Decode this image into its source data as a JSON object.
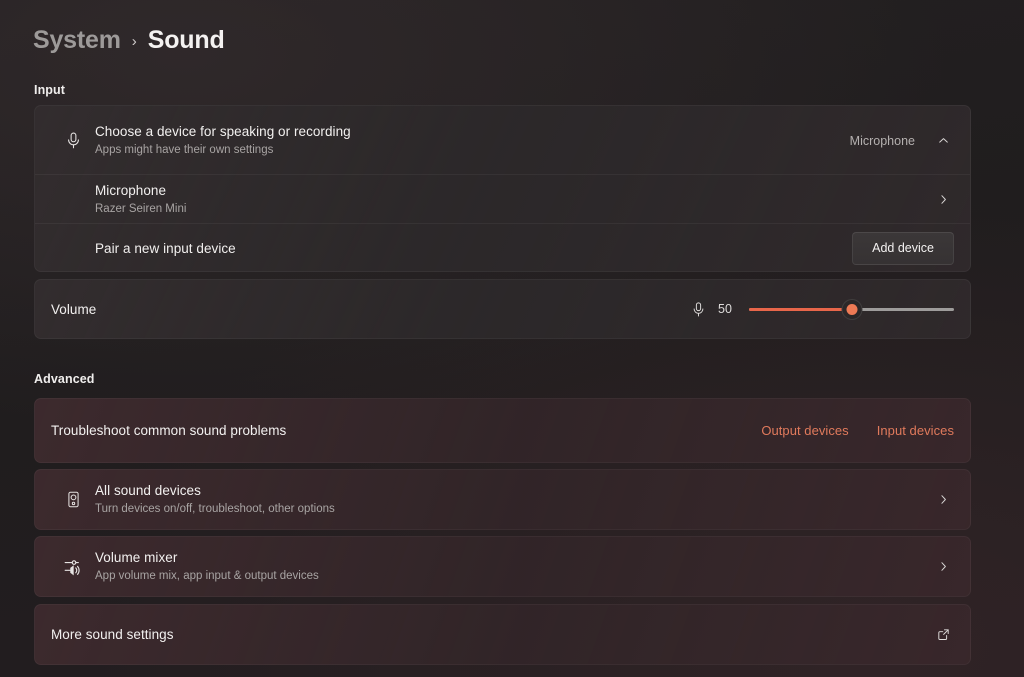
{
  "breadcrumb": {
    "parent": "System",
    "separator": "›",
    "current": "Sound"
  },
  "sections": {
    "input_heading": "Input",
    "advanced_heading": "Advanced"
  },
  "input": {
    "choose_device": {
      "icon": "microphone-icon",
      "title": "Choose a device for speaking or recording",
      "subtitle": "Apps might have their own settings",
      "selected_value": "Microphone",
      "expander_icon": "chevron-up-icon",
      "expanded": "true"
    },
    "device": {
      "title": "Microphone",
      "subtitle": "Razer Seiren Mini",
      "chevron_icon": "chevron-right-icon"
    },
    "pair": {
      "label": "Pair a new input device",
      "button_label": "Add device"
    },
    "volume": {
      "label": "Volume",
      "icon": "microphone-icon",
      "value": "50",
      "min": "0",
      "max": "100"
    }
  },
  "advanced": {
    "troubleshoot": {
      "label": "Troubleshoot common sound problems",
      "links": [
        {
          "label": "Output devices"
        },
        {
          "label": "Input devices"
        }
      ]
    },
    "all_devices": {
      "icon": "speaker-box-icon",
      "title": "All sound devices",
      "subtitle": "Turn devices on/off, troubleshoot, other options",
      "chevron_icon": "chevron-right-icon"
    },
    "volume_mixer": {
      "icon": "volume-mixer-icon",
      "title": "Volume mixer",
      "subtitle": "App volume mix, app input & output devices",
      "chevron_icon": "chevron-right-icon"
    },
    "more_settings": {
      "label": "More sound settings",
      "icon": "open-external-icon"
    }
  },
  "colors": {
    "accent": "#e8664a",
    "link": "#e07a5c",
    "page_background": "#201d1e",
    "card_background": "#2b2829",
    "text_primary": "#f2f0ef",
    "text_secondary": "#a8a4a3"
  }
}
